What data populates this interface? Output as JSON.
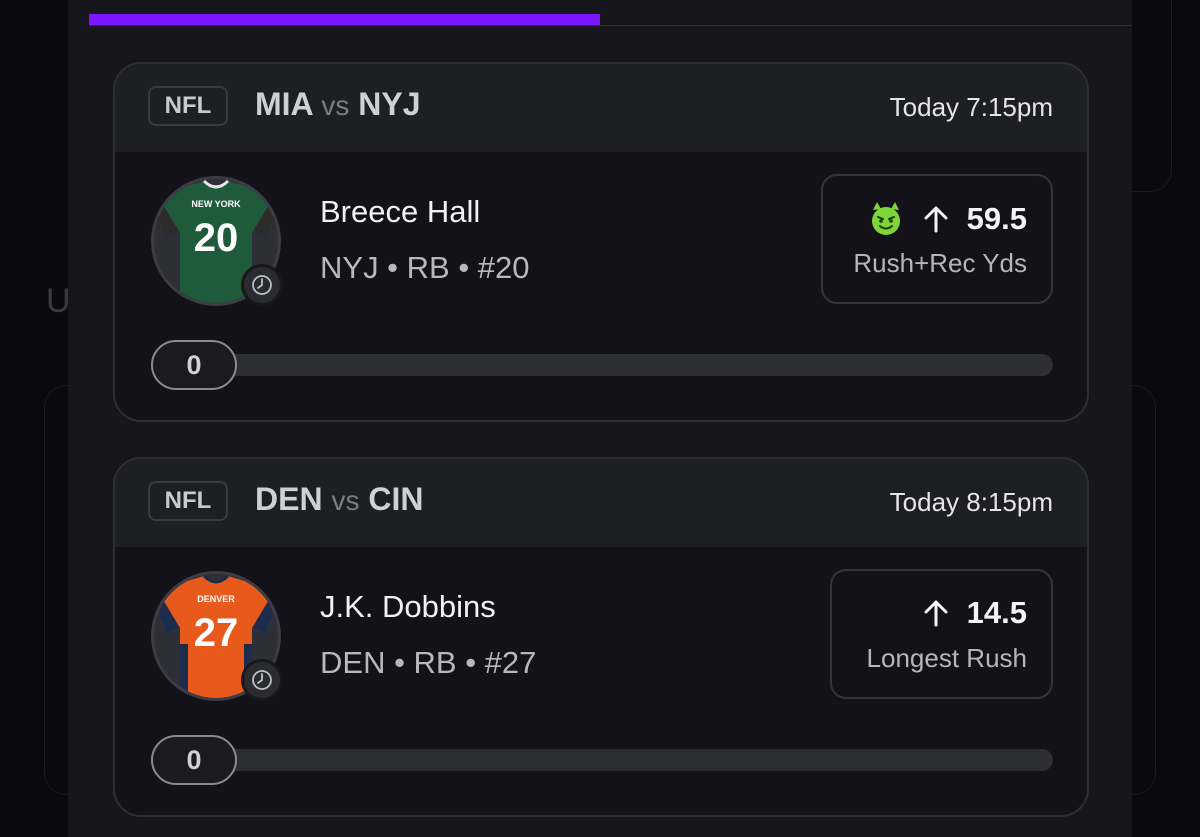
{
  "progress": {
    "fraction": 0.49,
    "color": "#7b16ff"
  },
  "background": {
    "left_letter": "U"
  },
  "cards": [
    {
      "league": "NFL",
      "team_away": "MIA",
      "vs": "vs",
      "team_home": "NYJ",
      "time": "Today 7:15pm",
      "player_name": "Breece Hall",
      "player_meta": "NYJ • RB • #20",
      "jersey": {
        "number": "20",
        "city": "NEW YORK",
        "color": "#1f5a3a"
      },
      "pick_icon": "devil-icon",
      "direction_icon": "arrow-up-icon",
      "line": "59.5",
      "stat_type": "Rush+Rec Yds",
      "current_value": "0"
    },
    {
      "league": "NFL",
      "team_away": "DEN",
      "vs": "vs",
      "team_home": "CIN",
      "time": "Today 8:15pm",
      "player_name": "J.K. Dobbins",
      "player_meta": "DEN • RB • #27",
      "jersey": {
        "number": "27",
        "city": "DENVER",
        "color": "#e85a1c"
      },
      "direction_icon": "arrow-up-icon",
      "line": "14.5",
      "stat_type": "Longest Rush",
      "current_value": "0"
    }
  ]
}
